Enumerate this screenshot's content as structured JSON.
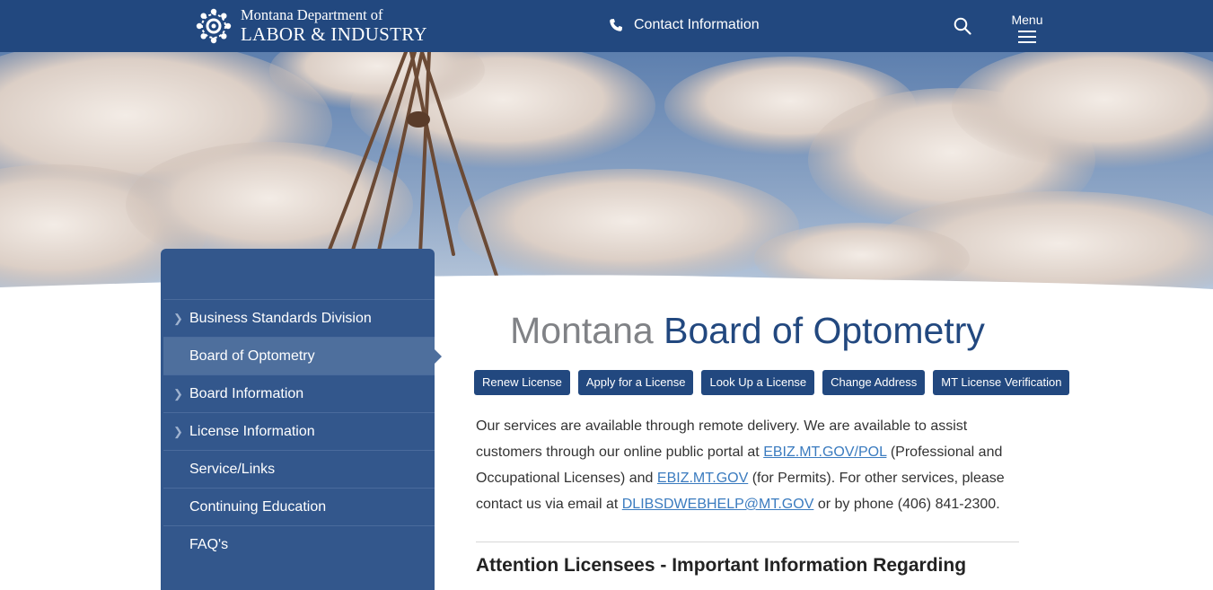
{
  "header": {
    "org_line1": "Montana Department of",
    "org_line2": "LABOR & INDUSTRY",
    "contact_label": "Contact Information",
    "menu_label": "Menu"
  },
  "colors": {
    "brand_navy": "#22487f",
    "sidebar_bg": "#33578c",
    "sidebar_active": "#4e6f9d",
    "link": "#3a7bbf",
    "title_gray": "#808286"
  },
  "sidebar": {
    "items": [
      {
        "label": "Business Standards Division",
        "chevron": true,
        "active": false
      },
      {
        "label": "Board of Optometry",
        "chevron": false,
        "active": true
      },
      {
        "label": "Board Information",
        "chevron": true,
        "active": false
      },
      {
        "label": "License Information",
        "chevron": true,
        "active": false
      },
      {
        "label": "Service/Links",
        "chevron": false,
        "active": false
      },
      {
        "label": "Continuing Education",
        "chevron": false,
        "active": false
      },
      {
        "label": "FAQ's",
        "chevron": false,
        "active": false
      }
    ]
  },
  "main": {
    "title_part1": "Montana",
    "title_part2": "Board of Optometry",
    "buttons": [
      "Renew License",
      "Apply for a License",
      "Look Up a License",
      "Change Address",
      "MT License Verification"
    ],
    "intro": {
      "text1": "Our services are available through remote delivery.  We are available to assist customers through our online public portal at ",
      "link1": "EBIZ.MT.GOV/POL",
      "text2": " (Professional and Occupational Licenses) and ",
      "link2": "EBIZ.MT.GOV",
      "text3": " (for Permits). For other services, please contact us via email at ",
      "link3": "DLIBSDWEBHELP@MT.GOV",
      "text4": " or by phone (406) 841-2300."
    },
    "subheading": "Attention Licensees - Important Information Regarding"
  },
  "icons": {
    "phone": "phone-icon",
    "search": "search-icon",
    "menu": "hamburger-icon",
    "logo": "star-seal-logo"
  }
}
